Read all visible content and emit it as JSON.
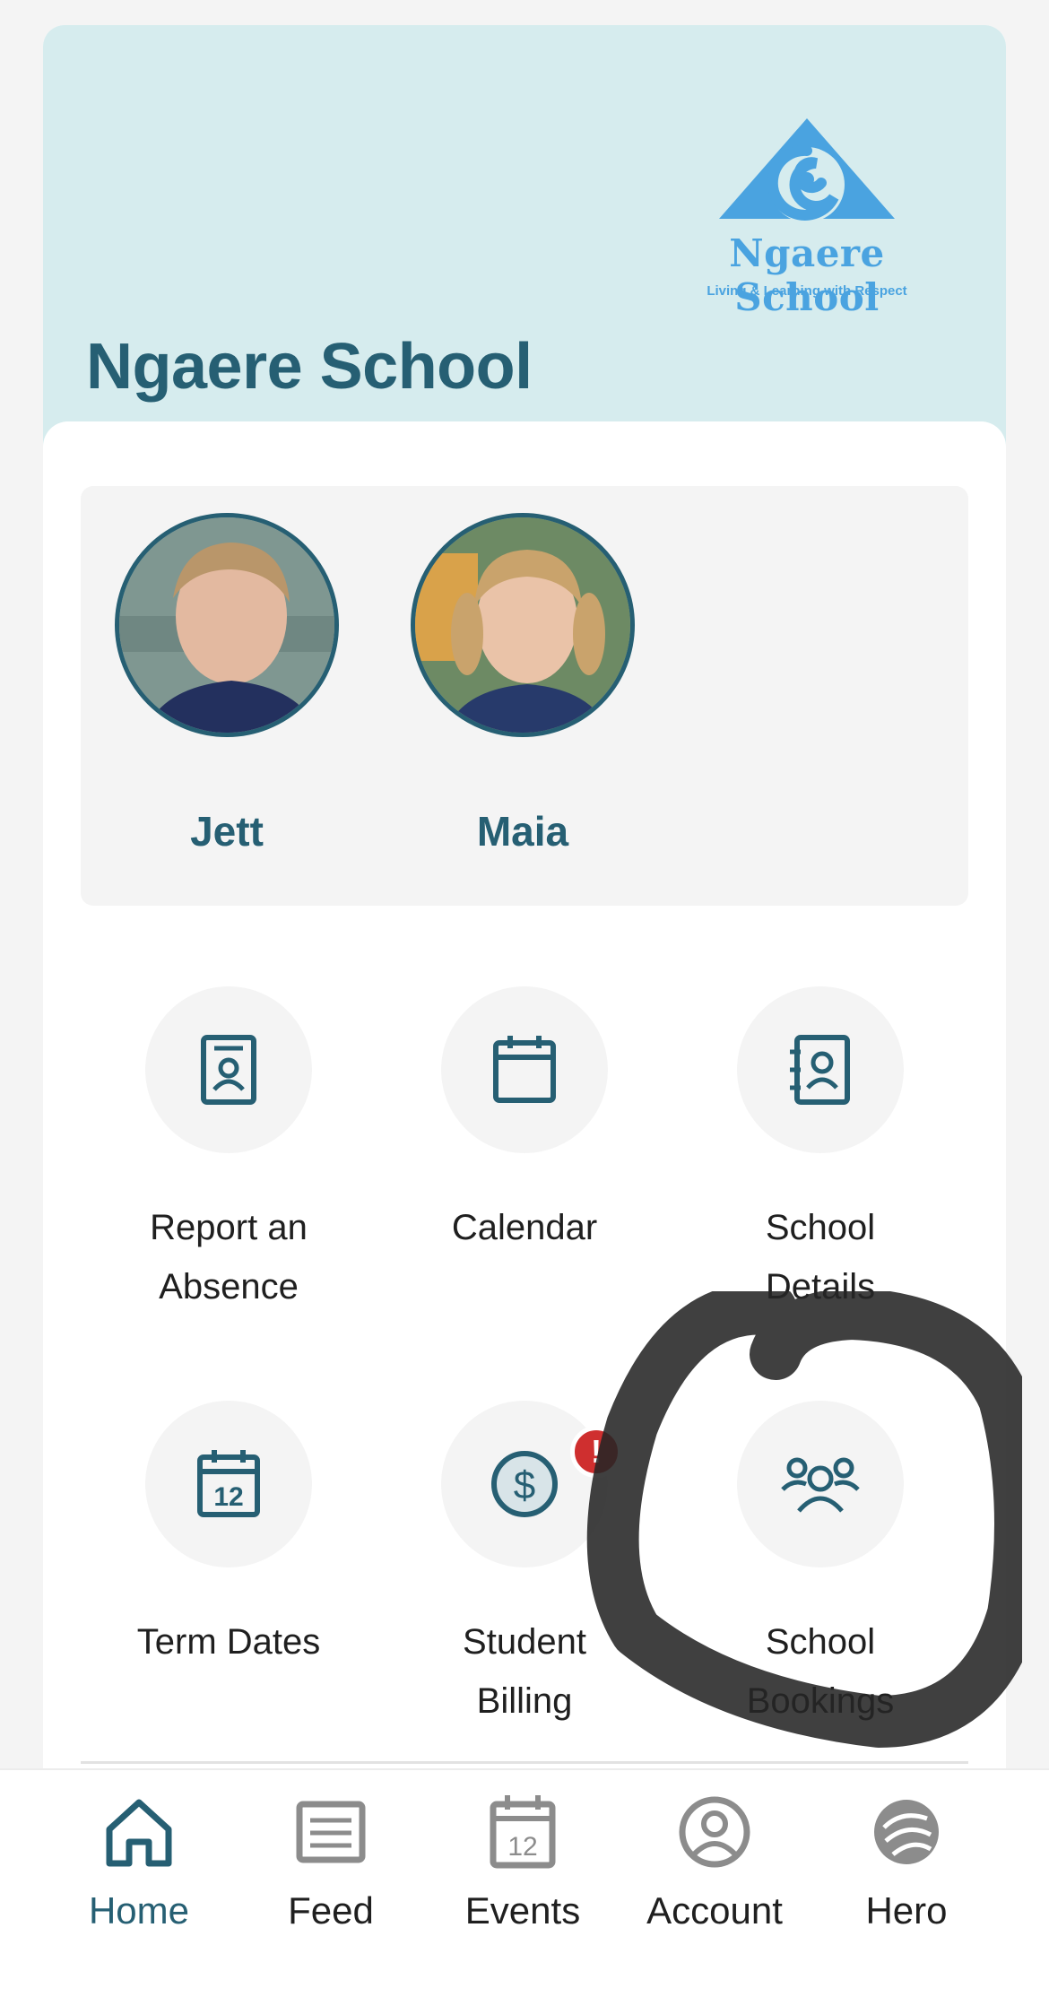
{
  "school": {
    "name": "Ngaere School",
    "logo_name": "Ngaere School",
    "logo_tagline": "Living & Learning with Respect"
  },
  "students": [
    {
      "name": "Jett"
    },
    {
      "name": "Maia"
    }
  ],
  "tiles": [
    {
      "label": "Report an\nAbsence",
      "icon": "contact-card-icon"
    },
    {
      "label": "Calendar",
      "icon": "calendar-icon"
    },
    {
      "label": "School\nDetails",
      "icon": "address-book-icon"
    },
    {
      "label": "Term Dates",
      "icon": "calendar-12-icon",
      "icon_text": "12"
    },
    {
      "label": "Student\nBilling",
      "icon": "dollar-icon",
      "badge": "!"
    },
    {
      "label": "School\nBookings",
      "icon": "group-icon"
    }
  ],
  "tabs": [
    {
      "label": "Home",
      "icon": "home-icon",
      "active": true
    },
    {
      "label": "Feed",
      "icon": "feed-icon"
    },
    {
      "label": "Events",
      "icon": "calendar-12-icon",
      "icon_text": "12"
    },
    {
      "label": "Account",
      "icon": "account-icon"
    },
    {
      "label": "Hero",
      "icon": "hero-logo-icon"
    }
  ],
  "colors": {
    "primary": "#265f73",
    "header_bg": "#d6ecee",
    "logo_blue": "#4aa3e0",
    "badge_red": "#cf2f2f",
    "tab_inactive": "#8c8c8c"
  }
}
